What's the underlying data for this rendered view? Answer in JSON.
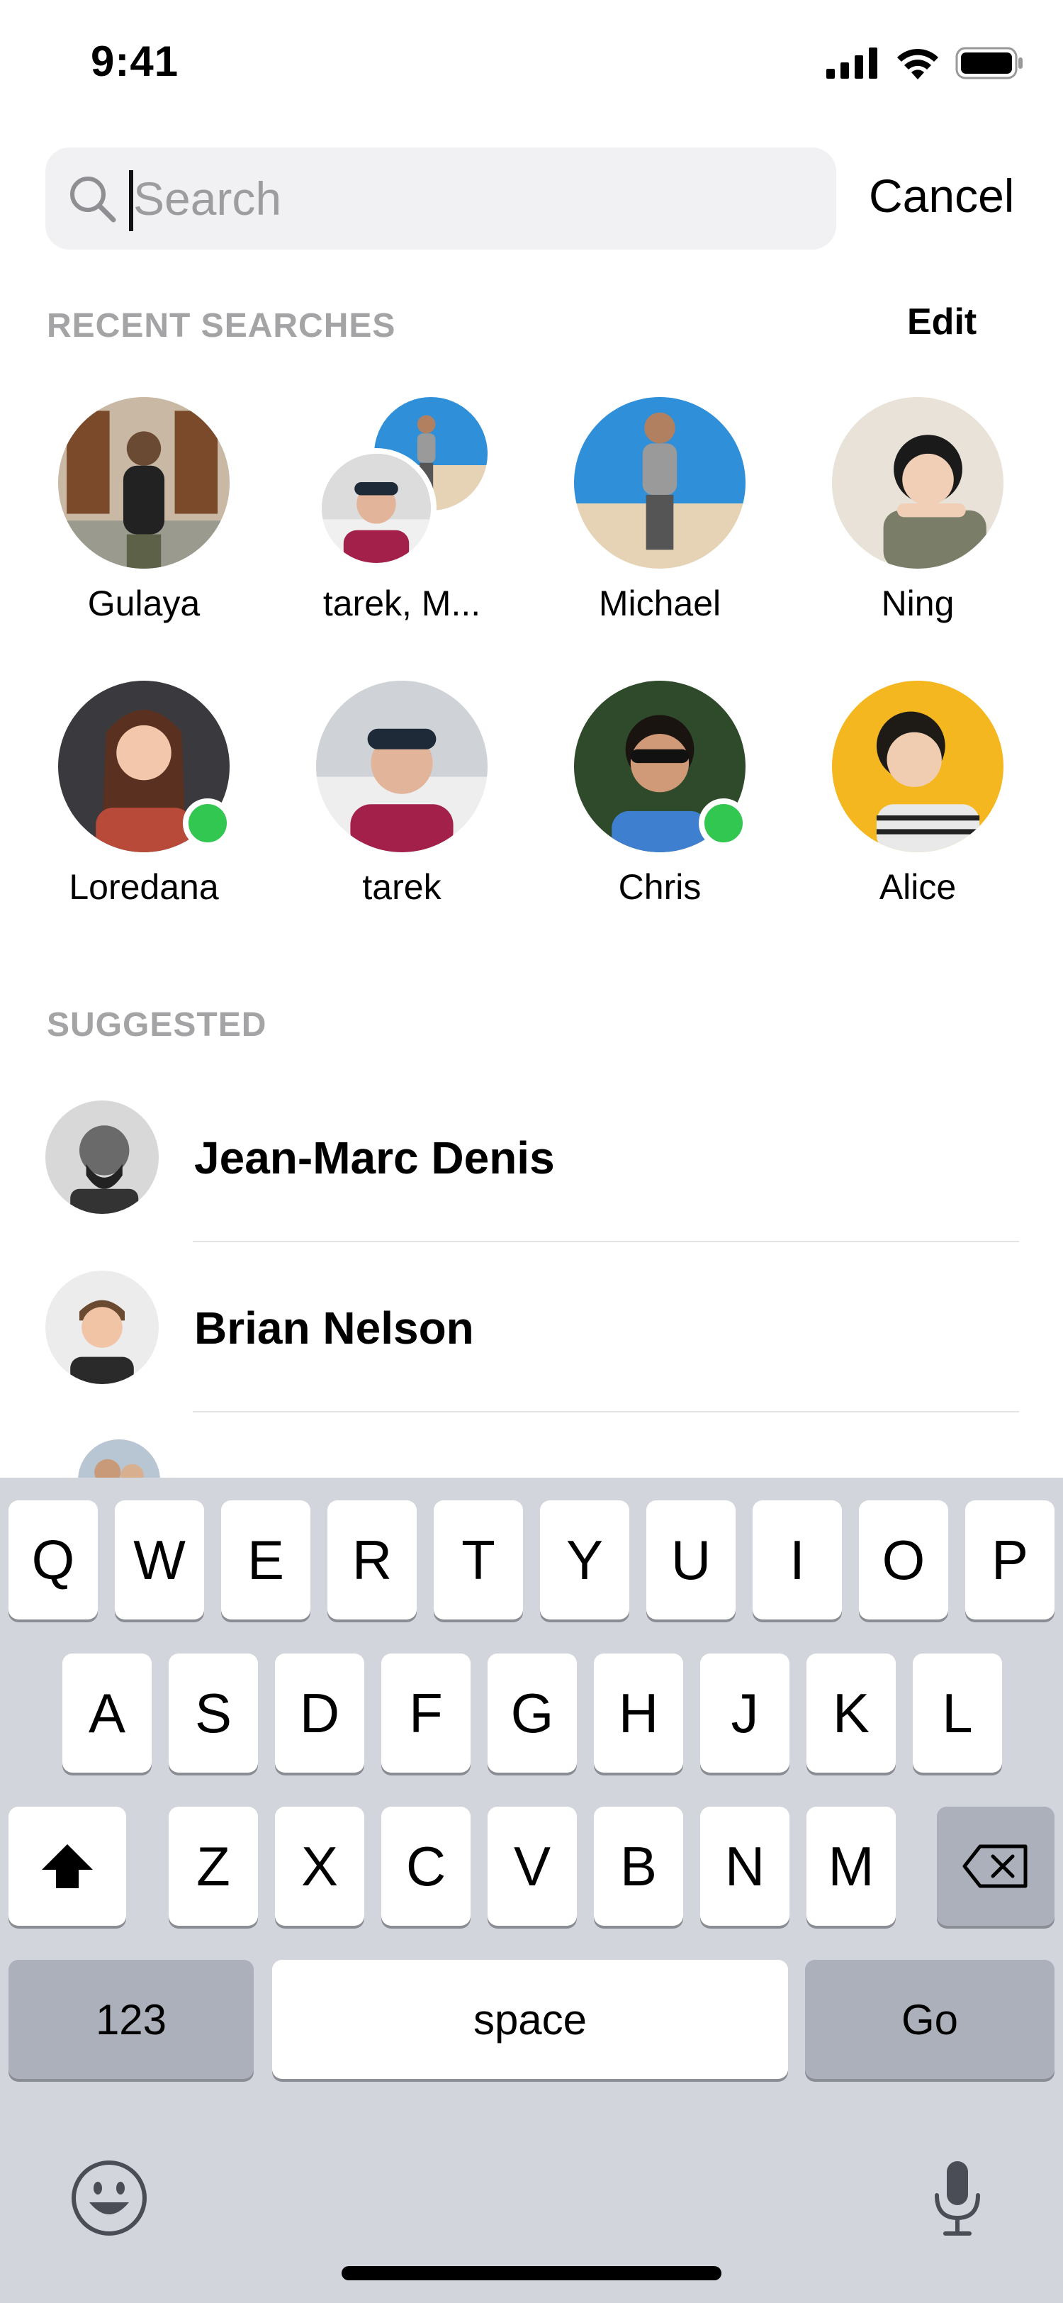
{
  "status_bar": {
    "time": "9:41"
  },
  "search": {
    "placeholder": "Search",
    "cancel_label": "Cancel"
  },
  "recent": {
    "title": "RECENT SEARCHES",
    "edit_label": "Edit",
    "people": [
      {
        "name": "Gulaya",
        "online": false
      },
      {
        "name": "tarek, M...",
        "online": false
      },
      {
        "name": "Michael",
        "online": false
      },
      {
        "name": "Ning",
        "online": false
      },
      {
        "name": "Loredana",
        "online": true
      },
      {
        "name": "tarek",
        "online": false
      },
      {
        "name": "Chris",
        "online": true
      },
      {
        "name": "Alice",
        "online": false
      }
    ]
  },
  "suggested": {
    "title": "SUGGESTED",
    "people": [
      {
        "name": "Jean-Marc Denis"
      },
      {
        "name": "Brian Nelson"
      }
    ]
  },
  "keyboard": {
    "row1": [
      "Q",
      "W",
      "E",
      "R",
      "T",
      "Y",
      "U",
      "I",
      "O",
      "P"
    ],
    "row2": [
      "A",
      "S",
      "D",
      "F",
      "G",
      "H",
      "J",
      "K",
      "L"
    ],
    "row3": [
      "Z",
      "X",
      "C",
      "V",
      "B",
      "N",
      "M"
    ],
    "numbers_label": "123",
    "space_label": "space",
    "go_label": "Go"
  },
  "colors": {
    "online": "#31c750",
    "keyboard_bg": "#d2d5db",
    "placeholder": "#9d9d9f"
  }
}
